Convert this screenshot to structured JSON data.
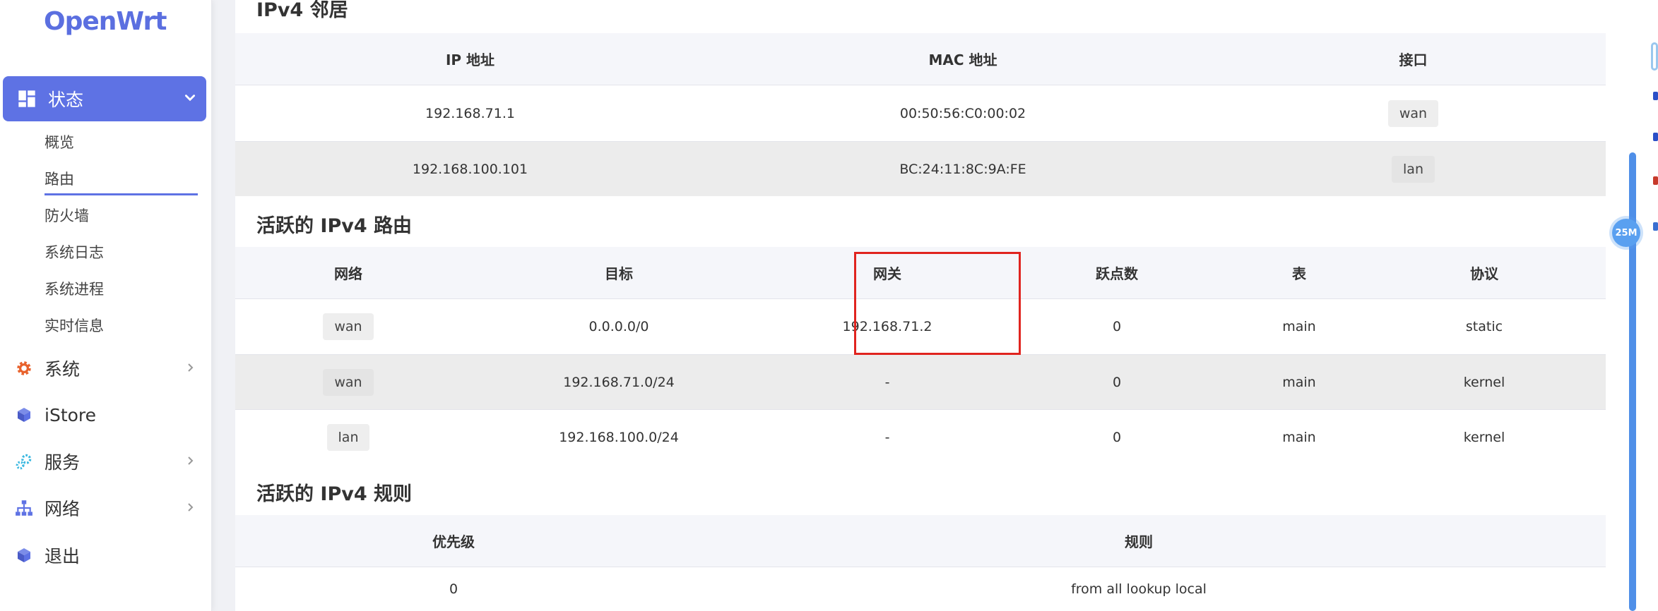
{
  "app": {
    "logo": "OpenWrt"
  },
  "sidebar": {
    "active": {
      "label": "状态"
    },
    "subitems": [
      "概览",
      "路由",
      "防火墙",
      "系统日志",
      "系统进程",
      "实时信息"
    ],
    "items": [
      {
        "label": "系统",
        "icon": "gear-icon",
        "has_children": true
      },
      {
        "label": "iStore",
        "icon": "cube-icon",
        "has_children": false
      },
      {
        "label": "服务",
        "icon": "cogs-icon",
        "has_children": true
      },
      {
        "label": "网络",
        "icon": "sitemap-icon",
        "has_children": true
      },
      {
        "label": "退出",
        "icon": "cube-icon",
        "has_children": false
      }
    ]
  },
  "neighbors": {
    "title": "IPv4 邻居",
    "headers": [
      "IP 地址",
      "MAC 地址",
      "接口"
    ],
    "rows": [
      [
        "192.168.71.1",
        "00:50:56:C0:00:02",
        "wan"
      ],
      [
        "192.168.100.101",
        "BC:24:11:8C:9A:FE",
        "lan"
      ]
    ]
  },
  "routes": {
    "title": "活跃的 IPv4 路由",
    "headers": [
      "网络",
      "目标",
      "网关",
      "跃点数",
      "表",
      "协议"
    ],
    "rows": [
      [
        "wan",
        "0.0.0.0/0",
        "192.168.71.2",
        "0",
        "main",
        "static"
      ],
      [
        "wan",
        "192.168.71.0/24",
        "-",
        "0",
        "main",
        "kernel"
      ],
      [
        "lan",
        "192.168.100.0/24",
        "-",
        "0",
        "main",
        "kernel"
      ]
    ]
  },
  "rules": {
    "title": "活跃的 IPv4 规则",
    "headers": [
      "优先级",
      "规则"
    ],
    "rows": [
      [
        "0",
        "from all lookup local"
      ]
    ]
  },
  "float_badge": "25M",
  "colors": {
    "accent": "#5e72e4",
    "highlight": "#e0241f"
  }
}
